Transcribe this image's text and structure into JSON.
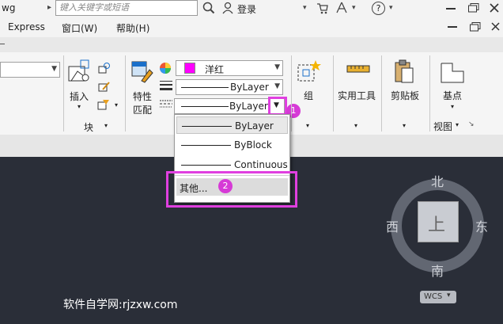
{
  "titlebar": {
    "doc_fragment": "wg",
    "search_placeholder": "键入关键字或短语",
    "login_label": "登录",
    "help_label": "?"
  },
  "menubar": {
    "items": [
      "Express",
      "窗口(W)",
      "帮助(H)"
    ]
  },
  "ribbon": {
    "block_group": {
      "insert_label": "插入",
      "group_label": "块"
    },
    "properties": {
      "match_label_1": "特性",
      "match_label_2": "匹配",
      "color_value": "洋红",
      "lineweight_value": "ByLayer",
      "linetype_value": "ByLayer"
    },
    "group_label": "组",
    "utilities_label": "实用工具",
    "clipboard_label": "剪贴板",
    "basepoint_label": "基点",
    "view_label": "视图"
  },
  "dropdown": {
    "options": [
      "ByLayer",
      "ByBlock",
      "Continuous"
    ],
    "other_label": "其他..."
  },
  "badges": {
    "one": "1",
    "two": "2"
  },
  "viewcube": {
    "north": "北",
    "south": "南",
    "east": "东",
    "west": "西",
    "face": "上",
    "wcs": "WCS"
  },
  "watermark": "软件自学网:rjzxw.com",
  "colors": {
    "highlight": "#e040e0",
    "magenta_swatch": "#ff00ff",
    "canvas": "#2a2e38"
  }
}
